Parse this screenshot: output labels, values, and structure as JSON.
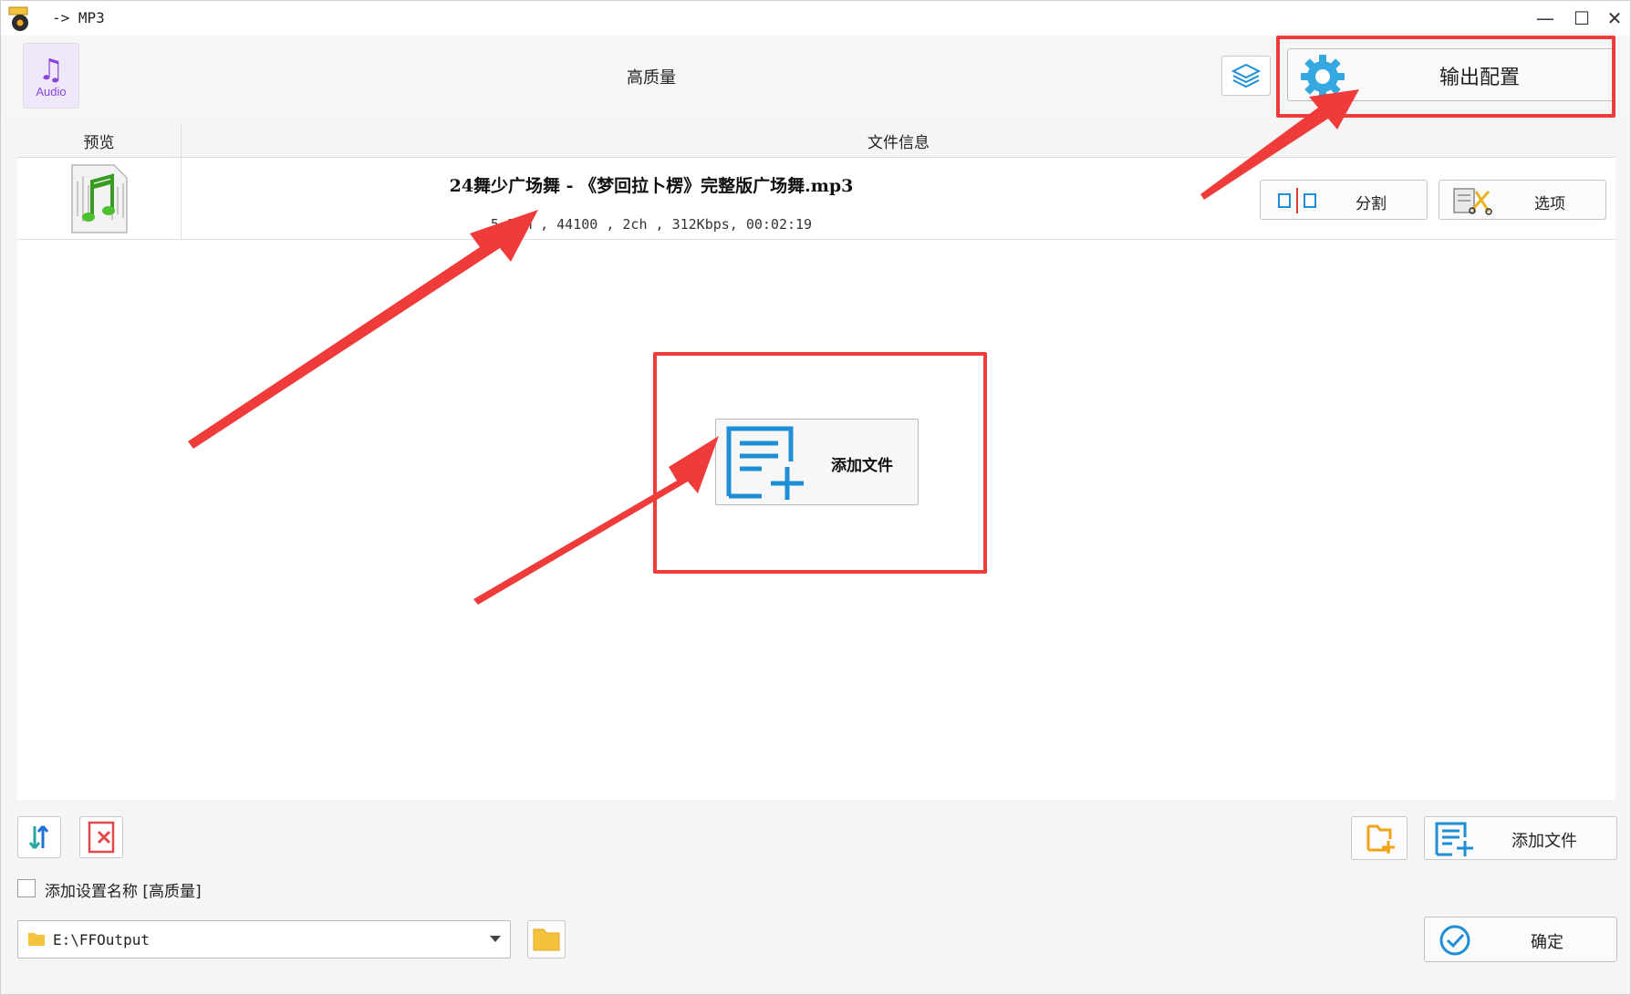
{
  "window": {
    "title": "-> MP3",
    "minimize_glyph": "—",
    "maximize_glyph": "☐",
    "close_glyph": "✕"
  },
  "header": {
    "format_icon_label": "Audio",
    "format_icon_glyph": "♫",
    "quality": "高质量",
    "output_config_label": "输出配置"
  },
  "list": {
    "columns": {
      "preview": "预览",
      "file_info": "文件信息"
    },
    "items": [
      {
        "name": "24舞少广场舞 - 《梦回拉卜楞》完整版广场舞.mp3",
        "meta": "5.32M , 44100 , 2ch , 312Kbps, 00:02:19",
        "split_label": "分割",
        "options_label": "选项"
      }
    ]
  },
  "center": {
    "add_file_label": "添加文件"
  },
  "bottom": {
    "add_file_label": "添加文件",
    "add_setting_name_label": "添加设置名称 [高质量]",
    "add_setting_name_checked": false,
    "output_path": "E:\\FFOutput",
    "ok_label": "确定"
  },
  "colors": {
    "highlight_red": "#f03b3b",
    "accent_blue": "#1e8fd6",
    "folder_yellow": "#f5c23e",
    "audio_purple": "#8a45d8"
  },
  "icons": [
    "app-icon",
    "audio-format-icon",
    "layers-icon",
    "gear-icon",
    "music-file-icon",
    "split-icon",
    "options-icon",
    "add-file-icon",
    "sort-icon",
    "clear-list-icon",
    "add-folder-icon",
    "folder-icon",
    "check-circle-icon",
    "dropdown-caret-icon"
  ]
}
